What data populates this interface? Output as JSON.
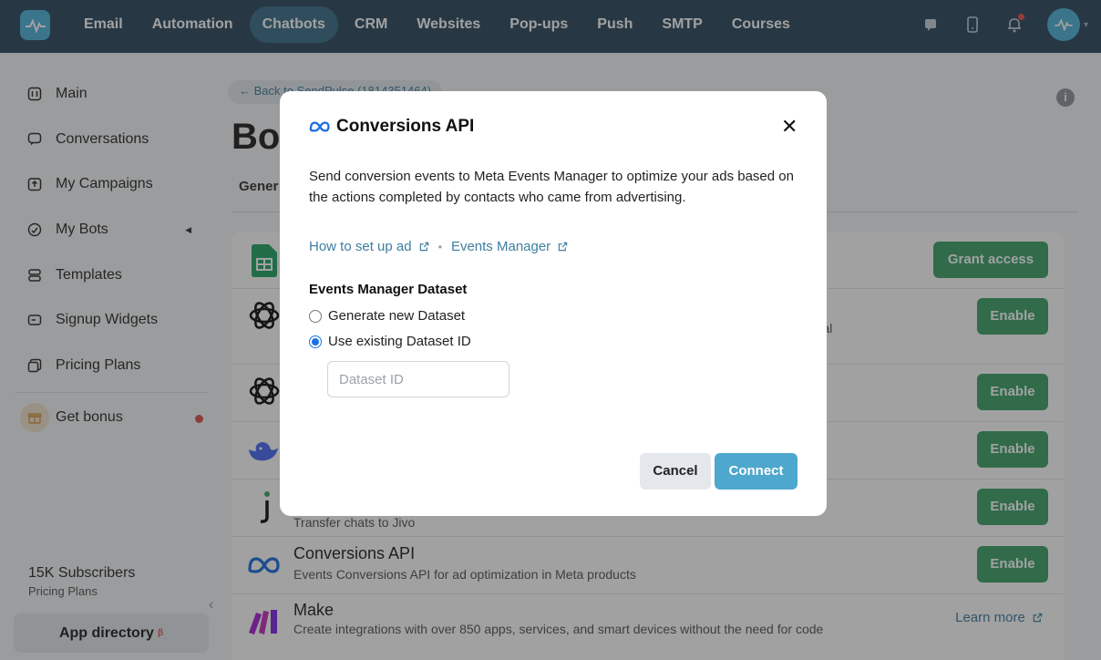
{
  "topnav": {
    "items": [
      {
        "label": "Email",
        "active": false
      },
      {
        "label": "Automation",
        "active": false
      },
      {
        "label": "Chatbots",
        "active": true
      },
      {
        "label": "CRM",
        "active": false
      },
      {
        "label": "Websites",
        "active": false
      },
      {
        "label": "Pop-ups",
        "active": false
      },
      {
        "label": "Push",
        "active": false
      },
      {
        "label": "SMTP",
        "active": false
      },
      {
        "label": "Courses",
        "active": false
      }
    ],
    "icons": [
      "chat-icon",
      "phone-icon",
      "bell-icon",
      "avatar"
    ]
  },
  "sidebar": {
    "items": [
      {
        "label": "Main",
        "icon": "main-icon"
      },
      {
        "label": "Conversations",
        "icon": "conversations-icon"
      },
      {
        "label": "My Campaigns",
        "icon": "campaigns-icon"
      },
      {
        "label": "My Bots",
        "icon": "bots-icon"
      },
      {
        "label": "Templates",
        "icon": "templates-icon"
      },
      {
        "label": "Signup Widgets",
        "icon": "widgets-icon"
      },
      {
        "label": "Pricing Plans",
        "icon": "pricing-icon"
      }
    ],
    "bonus_label": "Get bonus",
    "subscribers": "15K Subscribers",
    "subscribers_sub": "Pricing Plans",
    "app_directory": "App directory",
    "beta": "β"
  },
  "main": {
    "back_link": "← Back to SendPulse (1814351464)",
    "title": "Bo",
    "tab_general": "Gener",
    "rows": [
      {
        "title": "",
        "desc": "",
        "button": "Grant access"
      },
      {
        "title": "",
        "desc": "ural",
        "button": "Enable"
      },
      {
        "title": "",
        "desc": "",
        "button": "Enable"
      },
      {
        "title": "",
        "desc": "",
        "button": "Enable"
      },
      {
        "title": "",
        "desc": "Transfer chats to Jivo",
        "button": "Enable"
      },
      {
        "title": "Conversions API",
        "desc": "Events Conversions API for ad optimization in Meta products",
        "button": "Enable"
      },
      {
        "title": "Make",
        "desc": "Create integrations with over 850 apps, services, and smart devices without the need for code",
        "button": "Learn more"
      }
    ]
  },
  "modal": {
    "title": "Conversions API",
    "description": "Send conversion events to Meta Events Manager to optimize your ads based on the actions completed by contacts who came from advertising.",
    "link_setup": "How to set up ad",
    "link_events": "Events Manager",
    "dataset_label": "Events Manager Dataset",
    "option_generate": "Generate new Dataset",
    "option_existing": "Use existing Dataset ID",
    "selected_option": "existing",
    "input_placeholder": "Dataset ID",
    "input_value": "",
    "cancel": "Cancel",
    "connect": "Connect"
  },
  "colors": {
    "topbar": "#2e4a5f",
    "accent": "#4ea7cd",
    "enable_button": "#3fa36a",
    "link": "#3e7ea0"
  }
}
